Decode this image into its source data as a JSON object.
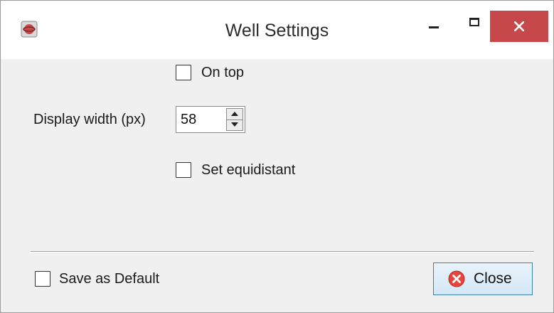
{
  "window": {
    "title": "Well Settings",
    "close_bg": "#c7484b"
  },
  "options": {
    "on_top": {
      "label": "On top",
      "checked": false
    },
    "display_width": {
      "label": "Display width (px)",
      "value": "58"
    },
    "set_equidistant": {
      "label": "Set equidistant",
      "checked": false
    }
  },
  "footer": {
    "save_default": {
      "label": "Save as Default",
      "checked": false
    },
    "close_button": {
      "label": "Close",
      "icon": "close-circle-icon"
    }
  }
}
